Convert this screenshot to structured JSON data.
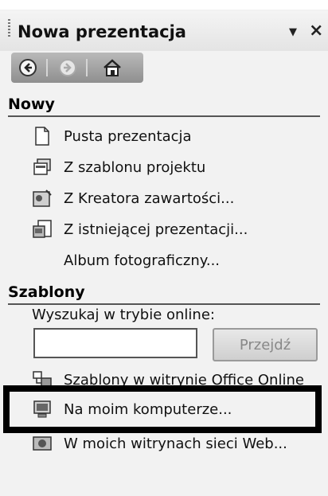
{
  "header": {
    "title": "Nowa prezentacja",
    "dropdown_icon": "triangle-down",
    "close_label": "×"
  },
  "nav": {
    "back_icon": "back-arrow",
    "forward_icon": "forward-arrow",
    "home_icon": "home"
  },
  "nowy": {
    "heading": "Nowy",
    "items": [
      {
        "label": "Pusta prezentacja",
        "icon": "blank-document"
      },
      {
        "label": "Z szablonu projektu",
        "icon": "design-template"
      },
      {
        "label": "Z Kreatora zawartości...",
        "icon": "autocontent-wizard"
      },
      {
        "label": "Z istniejącej prezentacji...",
        "icon": "existing-presentation"
      },
      {
        "label": "Album fotograficzny...",
        "icon": ""
      }
    ]
  },
  "szablony": {
    "heading": "Szablony",
    "search_label": "Wyszukaj w trybie online:",
    "search_value": "",
    "go_label": "Przejdź",
    "items": [
      {
        "label": "Szablony w witrynie Office Online",
        "icon": "office-online"
      },
      {
        "label": "Na moim komputerze...",
        "icon": "my-computer",
        "highlighted": true
      },
      {
        "label": "W moich witrynach sieci Web...",
        "icon": "web-sites"
      }
    ]
  },
  "colors": {
    "highlight_border": "#000000",
    "nav_bar": "#9f9f9f"
  }
}
